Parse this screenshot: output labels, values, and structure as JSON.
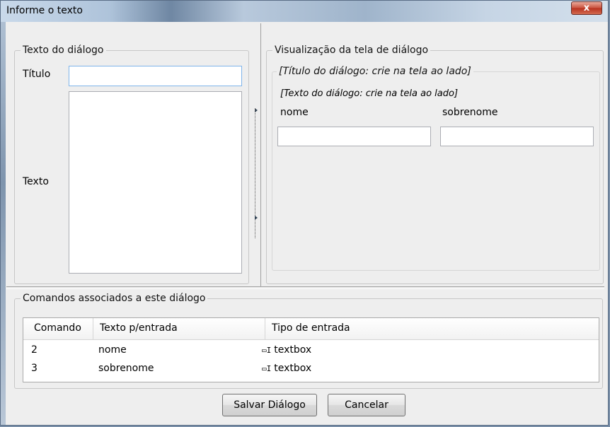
{
  "window": {
    "title": "Informe o texto",
    "close_glyph": "x"
  },
  "left_group": {
    "legend": "Texto do diálogo",
    "titulo_label": "Título",
    "titulo_value": "",
    "texto_label": "Texto",
    "texto_value": ""
  },
  "preview_group": {
    "legend": "Visualização da tela de diálogo",
    "inner_legend": "[Título do diálogo: crie na tela ao lado]",
    "text_line": "[Texto do diálogo: crie na tela ao lado]",
    "fields": [
      {
        "label": "nome",
        "value": ""
      },
      {
        "label": "sobrenome",
        "value": ""
      }
    ]
  },
  "commands_group": {
    "legend": "Comandos associados a este diálogo",
    "columns": [
      "Comando",
      "Texto p/entrada",
      "Tipo de entrada"
    ],
    "rows": [
      {
        "comando": "2",
        "texto": "nome",
        "tipo_icon": "textbox-icon",
        "tipo": "textbox"
      },
      {
        "comando": "3",
        "texto": "sobrenome",
        "tipo_icon": "textbox-icon",
        "tipo": "textbox"
      }
    ]
  },
  "buttons": {
    "save": "Salvar Diálogo",
    "cancel": "Cancelar"
  }
}
